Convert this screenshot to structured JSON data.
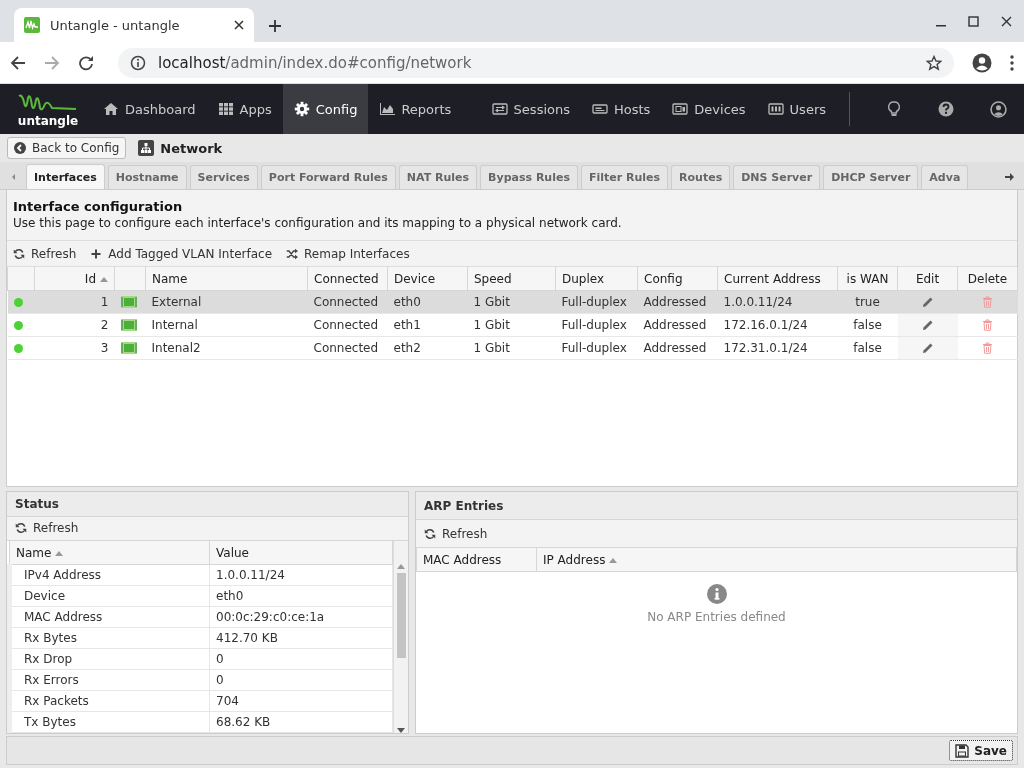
{
  "browser": {
    "tab_title": "Untangle - untangle",
    "url_host": "localhost",
    "url_path": "/admin/index.do#config/network"
  },
  "nav": {
    "logo_text": "untangle",
    "items": [
      {
        "label": "Dashboard",
        "selected": false
      },
      {
        "label": "Apps",
        "selected": false
      },
      {
        "label": "Config",
        "selected": true
      },
      {
        "label": "Reports",
        "selected": false
      }
    ],
    "right_items": [
      {
        "label": "Sessions"
      },
      {
        "label": "Hosts"
      },
      {
        "label": "Devices"
      },
      {
        "label": "Users"
      }
    ]
  },
  "back_button": "Back to Config",
  "page_title": "Network",
  "tabs": [
    {
      "label": "Interfaces",
      "selected": true
    },
    {
      "label": "Hostname",
      "selected": false
    },
    {
      "label": "Services",
      "selected": false
    },
    {
      "label": "Port Forward Rules",
      "selected": false
    },
    {
      "label": "NAT Rules",
      "selected": false
    },
    {
      "label": "Bypass Rules",
      "selected": false
    },
    {
      "label": "Filter Rules",
      "selected": false
    },
    {
      "label": "Routes",
      "selected": false
    },
    {
      "label": "DNS Server",
      "selected": false
    },
    {
      "label": "DHCP Server",
      "selected": false
    },
    {
      "label": "Adva",
      "selected": false
    }
  ],
  "section": {
    "title": "Interface configuration",
    "description": "Use this page to configure each interface's configuration and its mapping to a physical network card."
  },
  "toolbar": [
    {
      "label": "Refresh"
    },
    {
      "label": "Add Tagged VLAN Interface"
    },
    {
      "label": "Remap Interfaces"
    }
  ],
  "table": {
    "columns": [
      "Id",
      "Name",
      "Connected",
      "Device",
      "Speed",
      "Duplex",
      "Config",
      "Current Address",
      "is WAN",
      "Edit",
      "Delete"
    ],
    "rows": [
      {
        "selected": true,
        "id": "1",
        "name": "External",
        "connected": "Connected",
        "device": "eth0",
        "speed": "1 Gbit",
        "duplex": "Full-duplex",
        "config": "Addressed",
        "address": "1.0.0.11/24",
        "is_wan": "true"
      },
      {
        "selected": false,
        "id": "2",
        "name": "Internal",
        "connected": "Connected",
        "device": "eth1",
        "speed": "1 Gbit",
        "duplex": "Full-duplex",
        "config": "Addressed",
        "address": "172.16.0.1/24",
        "is_wan": "false"
      },
      {
        "selected": false,
        "id": "3",
        "name": "Intenal2",
        "connected": "Connected",
        "device": "eth2",
        "speed": "1 Gbit",
        "duplex": "Full-duplex",
        "config": "Addressed",
        "address": "172.31.0.1/24",
        "is_wan": "false"
      }
    ]
  },
  "status_panel": {
    "title": "Status",
    "refresh": "Refresh",
    "columns": [
      "Name",
      "Value"
    ],
    "rows": [
      {
        "name": "IPv4 Address",
        "value": "1.0.0.11/24"
      },
      {
        "name": "Device",
        "value": "eth0"
      },
      {
        "name": "MAC Address",
        "value": "00:0c:29:c0:ce:1a"
      },
      {
        "name": "Rx Bytes",
        "value": "412.70 KB"
      },
      {
        "name": "Rx Drop",
        "value": "0"
      },
      {
        "name": "Rx Errors",
        "value": "0"
      },
      {
        "name": "Rx Packets",
        "value": "704"
      },
      {
        "name": "Tx Bytes",
        "value": "68.62 KB"
      }
    ]
  },
  "arp_panel": {
    "title": "ARP Entries",
    "refresh": "Refresh",
    "columns": [
      "MAC Address",
      "IP Address"
    ],
    "empty_message": "No ARP Entries defined"
  },
  "save_button": "Save"
}
